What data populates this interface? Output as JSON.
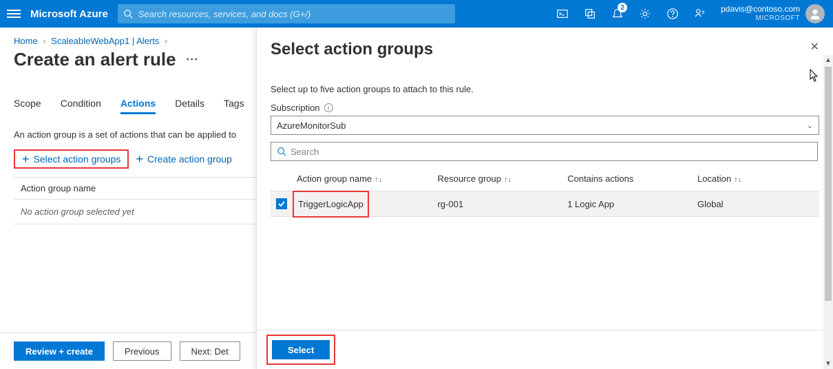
{
  "header": {
    "brand": "Microsoft Azure",
    "search_placeholder": "Search resources, services, and docs (G+/)",
    "notif_badge": "2",
    "user_email": "pdavis@contoso.com",
    "tenant": "MICROSOFT"
  },
  "crumbs": {
    "a": "Home",
    "b": "ScaleableWebApp1 | Alerts"
  },
  "page_title": "Create an alert rule",
  "tabs": {
    "scope": "Scope",
    "condition": "Condition",
    "actions": "Actions",
    "details": "Details",
    "tags": "Tags"
  },
  "desc": "An action group is a set of actions that can be applied to",
  "buttons": {
    "select_ag": "Select action groups",
    "create_ag": "Create action group"
  },
  "table": {
    "head": "Action group name",
    "empty": "No action group selected yet"
  },
  "footer": {
    "review": "Review + create",
    "prev": "Previous",
    "next": "Next: Det"
  },
  "blade": {
    "title": "Select action groups",
    "desc": "Select up to five action groups to attach to this rule.",
    "sub_label": "Subscription",
    "sub_value": "AzureMonitorSub",
    "search_placeholder": "Search",
    "cols": {
      "name": "Action group name",
      "rg": "Resource group",
      "actions": "Contains actions",
      "loc": "Location"
    },
    "row": {
      "name": "TriggerLogicApp",
      "rg": "rg-001",
      "actions": "1 Logic App",
      "loc": "Global"
    },
    "select": "Select"
  }
}
